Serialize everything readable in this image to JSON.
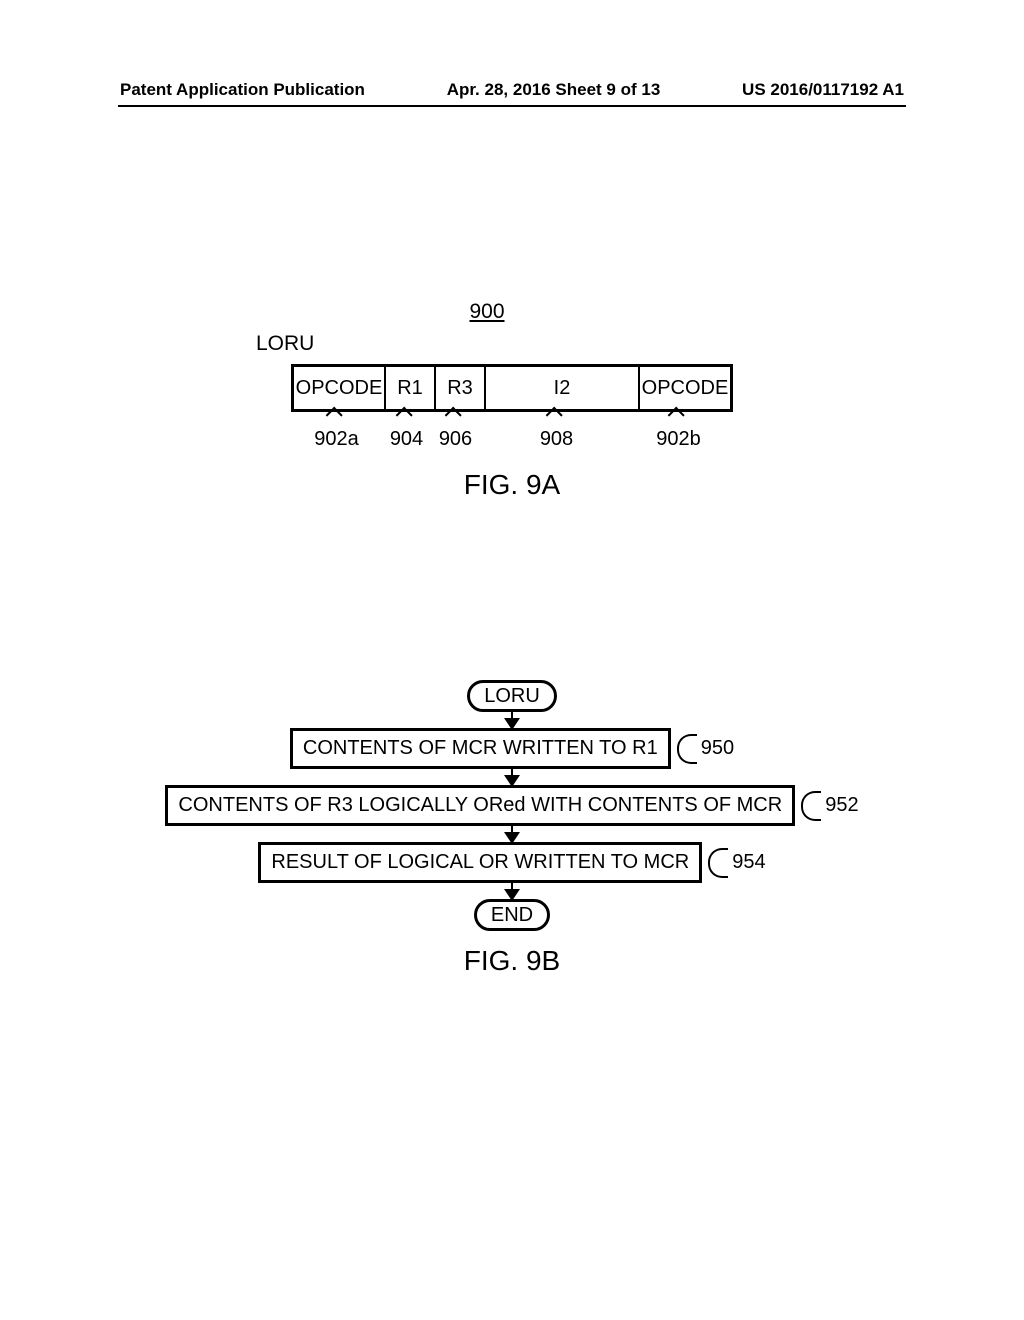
{
  "header": {
    "left": "Patent Application Publication",
    "center": "Apr. 28, 2016  Sheet 9 of 13",
    "right": "US 2016/0117192 A1"
  },
  "fig9a": {
    "refnum": "900",
    "mnemonic": "LORU",
    "cells": {
      "c0": "OPCODE",
      "c1": "R1",
      "c2": "R3",
      "c3": "I2",
      "c4": "OPCODE"
    },
    "callouts": {
      "c0": "902a",
      "c1": "904",
      "c2": "906",
      "c3": "908",
      "c4": "902b"
    },
    "caption": "FIG. 9A"
  },
  "fig9b": {
    "start": "LORU",
    "steps": [
      {
        "text": "CONTENTS OF MCR WRITTEN TO R1",
        "ref": "950"
      },
      {
        "text": "CONTENTS OF R3 LOGICALLY ORed WITH CONTENTS OF MCR",
        "ref": "952"
      },
      {
        "text": "RESULT OF LOGICAL OR WRITTEN TO MCR",
        "ref": "954"
      }
    ],
    "end": "END",
    "caption": "FIG. 9B"
  }
}
